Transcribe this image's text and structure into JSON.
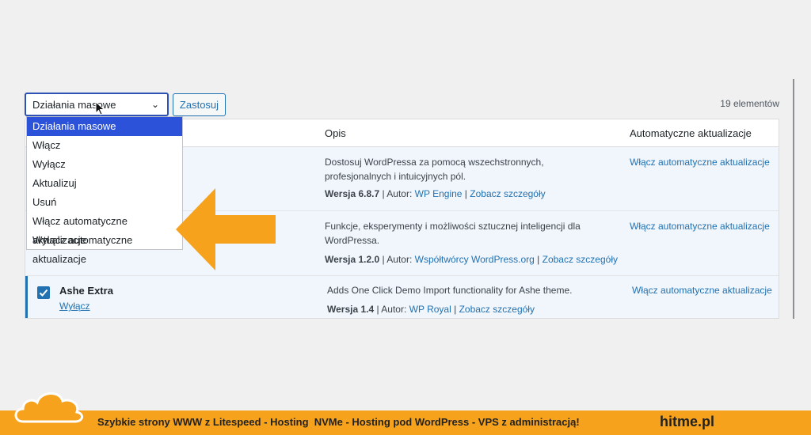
{
  "toolbar": {
    "bulk_select_value": "Działania masowe",
    "apply_label": "Zastosuj",
    "items_count": "19 elementów"
  },
  "dropdown": {
    "items": [
      "Działania masowe",
      "Włącz",
      "Wyłącz",
      "Aktualizuj",
      "Usuń",
      "Włącz automatyczne aktualizacje",
      "Wyłącz automatyczne aktualizacje"
    ],
    "selected_index": 0
  },
  "table": {
    "headers": {
      "description": "Opis",
      "auto_updates": "Automatyczne aktualizacje"
    },
    "rows": [
      {
        "description": "Dostosuj WordPressa za pomocą wszechstronnych, profesjonalnych i intuicyjnych pól.",
        "version_label": "Wersja 6.8.7",
        "sep1": " | Autor: ",
        "author": "WP Engine",
        "sep2": " | ",
        "details": "Zobacz szczegóły",
        "auto_update": "Włącz automatyczne aktualizacje"
      },
      {
        "description": "Funkcje, eksperymenty i możliwości sztucznej inteligencji dla WordPressa.",
        "version_label": "Wersja 1.2.0",
        "sep1": " | Autor: ",
        "author": "Współtwórcy WordPress.org",
        "sep2": " | ",
        "details": "Zobacz szczegóły",
        "auto_update": "Włącz automatyczne aktualizacje"
      },
      {
        "name": "Ashe Extra",
        "action": "Wyłącz",
        "checked": true,
        "description": "Adds One Click Demo Import functionality for Ashe theme.",
        "version_label": "Wersja 1.4",
        "sep1": " | Autor: ",
        "author": "WP Royal",
        "sep2": " | ",
        "details": "Zobacz szczegóły",
        "auto_update": "Włącz automatyczne aktualizacje"
      }
    ]
  },
  "footer": {
    "text": "Szybkie strony WWW z Litespeed - Hosting  NVMe - Hosting pod WordPress - VPS z administracją!",
    "brand": "hitme.pl"
  },
  "colors": {
    "accent": "#2271b1",
    "dropdown_highlight": "#2c52d9",
    "arrow": "#f7a21c",
    "footer_bg": "#f7a21c"
  },
  "icons": {
    "select_chevron": "chevron-down-icon",
    "cursor": "mouse-cursor-icon",
    "arrow": "left-arrow-icon",
    "logo": "cloud-logo-icon",
    "checkbox": "checkmark-icon"
  }
}
